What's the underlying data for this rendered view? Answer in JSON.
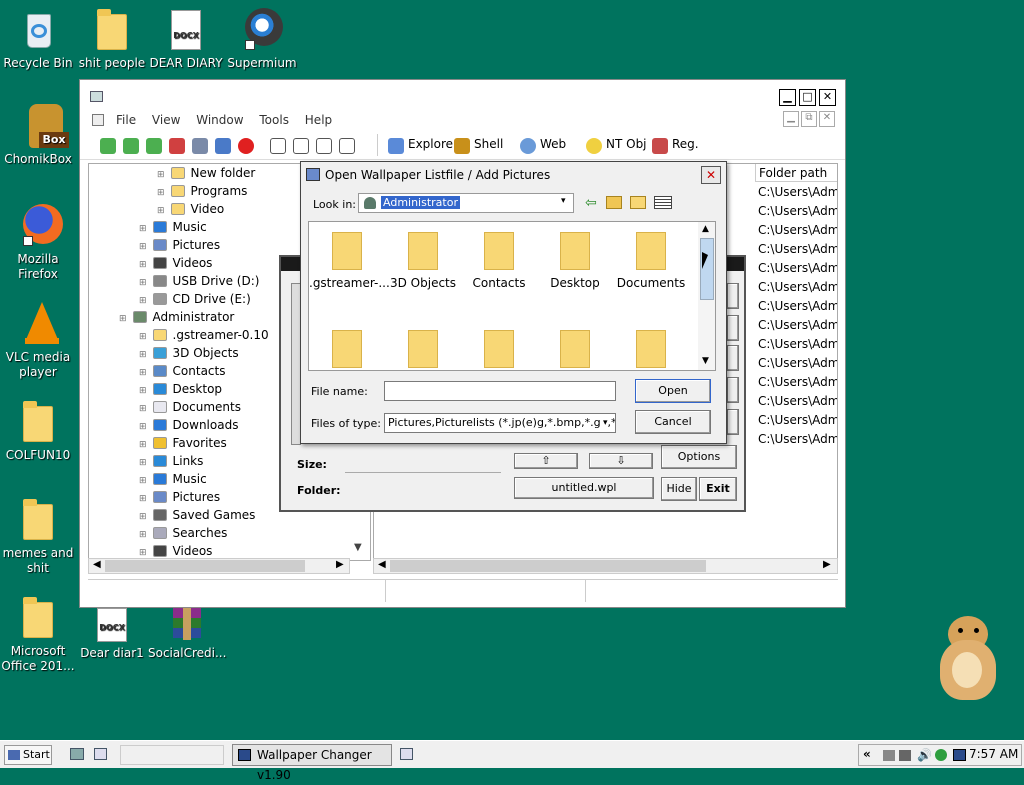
{
  "desktop": {
    "icons": [
      {
        "label": "Recycle Bin",
        "icon": "recycle-bin-icon"
      },
      {
        "label": "shit people",
        "icon": "folder-icon"
      },
      {
        "label": "DEAR DIARY",
        "icon": "docx-icon",
        "badge": "DOCX"
      },
      {
        "label": "Supermium",
        "icon": "supermium-icon"
      },
      {
        "label": "ChomikBox",
        "icon": "chomikbox-icon",
        "badge": "Box"
      },
      {
        "label": "Mozilla Firefox",
        "icon": "firefox-icon"
      },
      {
        "label": "VLC media player",
        "icon": "vlc-icon"
      },
      {
        "label": "COLFUN10",
        "icon": "folder-icon"
      },
      {
        "label": "memes and shit",
        "icon": "folder-icon"
      },
      {
        "label": "Microsoft Office 201...",
        "icon": "folder-icon"
      },
      {
        "label": "Dear diar1",
        "icon": "docx-icon",
        "badge": "DOCX"
      },
      {
        "label": "SocialCredi...",
        "icon": "winrar-icon"
      }
    ]
  },
  "main_window": {
    "menu": [
      "File",
      "View",
      "Window",
      "Tools",
      "Help"
    ],
    "toolbar_buttons": [
      "Explore",
      "Shell",
      "Web",
      "NT Obj",
      "Reg."
    ],
    "tree": [
      {
        "label": "New folder",
        "level": 3,
        "icon": "folder"
      },
      {
        "label": "Programs",
        "level": 3,
        "icon": "folder"
      },
      {
        "label": "Video",
        "level": 3,
        "icon": "folder"
      },
      {
        "label": "Music",
        "level": 2,
        "icon": "music"
      },
      {
        "label": "Pictures",
        "level": 2,
        "icon": "pictures"
      },
      {
        "label": "Videos",
        "level": 2,
        "icon": "videos"
      },
      {
        "label": "USB Drive (D:)",
        "level": 2,
        "icon": "drive"
      },
      {
        "label": "CD Drive (E:)",
        "level": 2,
        "icon": "cd"
      },
      {
        "label": "Administrator",
        "level": 1,
        "icon": "user"
      },
      {
        "label": ".gstreamer-0.10",
        "level": 2,
        "icon": "folder"
      },
      {
        "label": "3D Objects",
        "level": 2,
        "icon": "3d"
      },
      {
        "label": "Contacts",
        "level": 2,
        "icon": "contacts"
      },
      {
        "label": "Desktop",
        "level": 2,
        "icon": "desktop"
      },
      {
        "label": "Documents",
        "level": 2,
        "icon": "documents"
      },
      {
        "label": "Downloads",
        "level": 2,
        "icon": "downloads"
      },
      {
        "label": "Favorites",
        "level": 2,
        "icon": "favorites"
      },
      {
        "label": "Links",
        "level": 2,
        "icon": "links"
      },
      {
        "label": "Music",
        "level": 2,
        "icon": "music"
      },
      {
        "label": "Pictures",
        "level": 2,
        "icon": "pictures"
      },
      {
        "label": "Saved Games",
        "level": 2,
        "icon": "games"
      },
      {
        "label": "Searches",
        "level": 2,
        "icon": "searches"
      },
      {
        "label": "Videos",
        "level": 2,
        "icon": "videos"
      }
    ],
    "column_header": "Folder path",
    "paths": [
      "C:\\Users\\Adm",
      "C:\\Users\\Adm",
      "C:\\Users\\Adm",
      "C:\\Users\\Adm",
      "C:\\Users\\Adm",
      "C:\\Users\\Adm",
      "C:\\Users\\Adm",
      "C:\\Users\\Adm",
      "C:\\Users\\Adm",
      "C:\\Users\\Adm",
      "C:\\Users\\Adm",
      "C:\\Users\\Adm",
      "C:\\Users\\Adm",
      "C:\\Users\\Adm"
    ]
  },
  "wallpaper_dialog": {
    "size_label": "Size:",
    "folder_label": "Folder:",
    "file_name": "untitled.wpl",
    "options_label": "Options",
    "hide_label": "Hide",
    "exit_label": "Exit"
  },
  "open_dialog": {
    "title": "Open Wallpaper Listfile / Add Pictures",
    "look_in_label": "Look in:",
    "look_in_value": "Administrator",
    "items": [
      {
        "label": ".gstreamer-...",
        "icon": "folder-icon"
      },
      {
        "label": "3D Objects",
        "icon": "3d-objects-folder-icon"
      },
      {
        "label": "Contacts",
        "icon": "contacts-folder-icon"
      },
      {
        "label": "Desktop",
        "icon": "desktop-folder-icon"
      },
      {
        "label": "Documents",
        "icon": "documents-folder-icon"
      },
      {
        "label": "",
        "icon": "downloads-folder-icon"
      },
      {
        "label": "",
        "icon": "favorites-folder-icon"
      },
      {
        "label": "",
        "icon": "links-folder-icon"
      },
      {
        "label": "",
        "icon": "music-folder-icon"
      },
      {
        "label": "",
        "icon": "pictures-folder-icon"
      }
    ],
    "file_name_label": "File name:",
    "file_name_value": "",
    "file_type_label": "Files of type:",
    "file_type_value": "Pictures,Picturelists (*.jp(e)g,*.bmp,*.gif,*wp",
    "open_label": "Open",
    "cancel_label": "Cancel"
  },
  "taskbar": {
    "start_label": "Start",
    "task_label": "Wallpaper Changer v1.90",
    "clock": "7:57 AM"
  },
  "colors": {
    "desktop": "#00735e",
    "accent": "#3366cc",
    "folder": "#f8d775"
  }
}
